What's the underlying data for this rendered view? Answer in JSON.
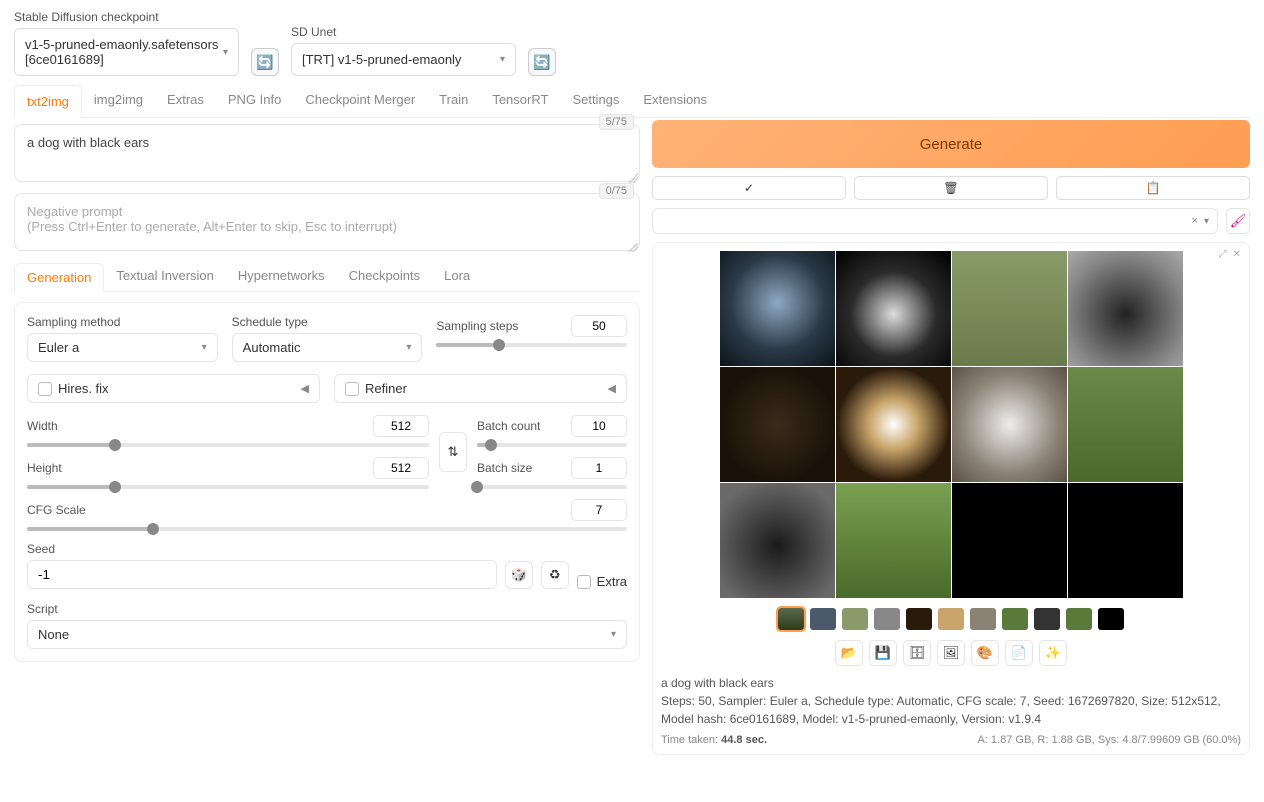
{
  "top": {
    "checkpoint_label": "Stable Diffusion checkpoint",
    "checkpoint_value": "v1-5-pruned-emaonly.safetensors [6ce0161689]",
    "unet_label": "SD Unet",
    "unet_value": "[TRT] v1-5-pruned-emaonly"
  },
  "tabs": [
    "txt2img",
    "img2img",
    "Extras",
    "PNG Info",
    "Checkpoint Merger",
    "Train",
    "TensorRT",
    "Settings",
    "Extensions"
  ],
  "prompt": {
    "value": "a dog with black ears",
    "token": "5/75",
    "neg_placeholder": "Negative prompt\n(Press Ctrl+Enter to generate, Alt+Enter to skip, Esc to interrupt)",
    "neg_token": "0/75"
  },
  "generate": "Generate",
  "subtabs": [
    "Generation",
    "Textual Inversion",
    "Hypernetworks",
    "Checkpoints",
    "Lora"
  ],
  "params": {
    "sampling_method_label": "Sampling method",
    "sampling_method": "Euler a",
    "schedule_label": "Schedule type",
    "schedule": "Automatic",
    "steps_label": "Sampling steps",
    "steps": "50",
    "hires": "Hires. fix",
    "refiner": "Refiner",
    "width_label": "Width",
    "width": "512",
    "height_label": "Height",
    "height": "512",
    "batch_count_label": "Batch count",
    "batch_count": "10",
    "batch_size_label": "Batch size",
    "batch_size": "1",
    "cfg_label": "CFG Scale",
    "cfg": "7",
    "seed_label": "Seed",
    "seed": "-1",
    "extra": "Extra",
    "script_label": "Script",
    "script": "None",
    "swap": "⇅"
  },
  "output": {
    "prompt_echo": "a dog with black ears",
    "meta": "Steps: 50, Sampler: Euler a, Schedule type: Automatic, CFG scale: 7, Seed: 1672697820, Size: 512x512, Model hash: 6ce0161689, Model: v1-5-pruned-emaonly, Version: v1.9.4",
    "time_label": "Time taken:",
    "time": "44.8 sec.",
    "mem": "A: 1.87 GB, R: 1.88 GB, Sys: 4.8/7.99609 GB (60.0%)"
  },
  "icons": {
    "refresh": "🔄",
    "check": "✓",
    "trash": "🗑",
    "paste": "📋",
    "x": "×",
    "caret": "▾",
    "edit": "🖌",
    "tri": "◀",
    "dice": "🎲",
    "recycle": "♻",
    "folder": "📂",
    "save": "💾",
    "zip": "🗄",
    "img": "🖼",
    "palette": "🎨",
    "doc": "📄",
    "star": "✨"
  }
}
